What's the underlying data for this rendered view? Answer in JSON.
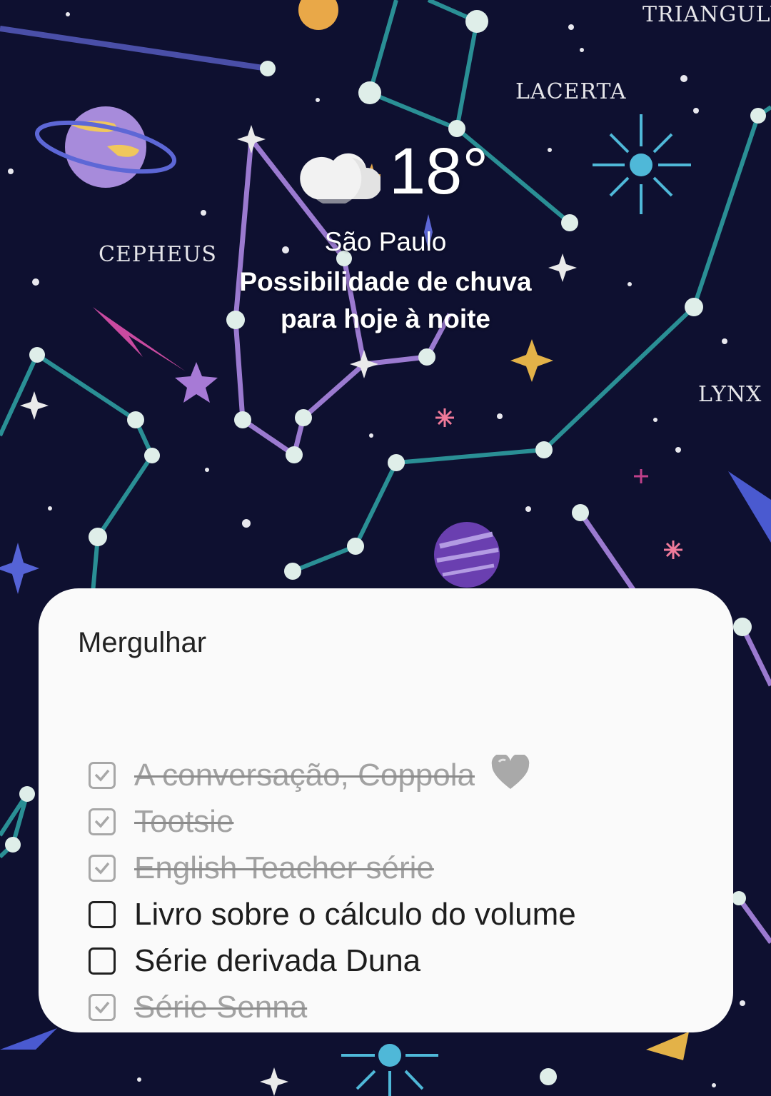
{
  "wallpaper": {
    "constellation_labels": [
      "TRIANGULUM",
      "LACERTA",
      "CEPHEUS",
      "LYNX"
    ]
  },
  "weather": {
    "icon": "partly-cloudy-icon",
    "temperature": "18°",
    "city": "São Paulo",
    "forecast_line1": "Possibilidade de chuva",
    "forecast_line2": "para hoje à noite"
  },
  "checklist": {
    "title": "Mergulhar",
    "items": [
      {
        "label": "A conversação, Coppola",
        "checked": true,
        "emoji": "grey-heart-icon"
      },
      {
        "label": "Tootsie",
        "checked": true
      },
      {
        "label": "English Teacher série",
        "checked": true
      },
      {
        "label": "Livro sobre o cálculo do volume",
        "checked": false
      },
      {
        "label": "Série derivada Duna",
        "checked": false
      },
      {
        "label": "Série Senna",
        "checked": true
      }
    ]
  },
  "colors": {
    "background": "#0e1030",
    "card": "#fafafa",
    "teal_lines": "#2a8f95",
    "purple_lines": "#9b7ad0",
    "checked_gray": "#a2a2a2"
  }
}
